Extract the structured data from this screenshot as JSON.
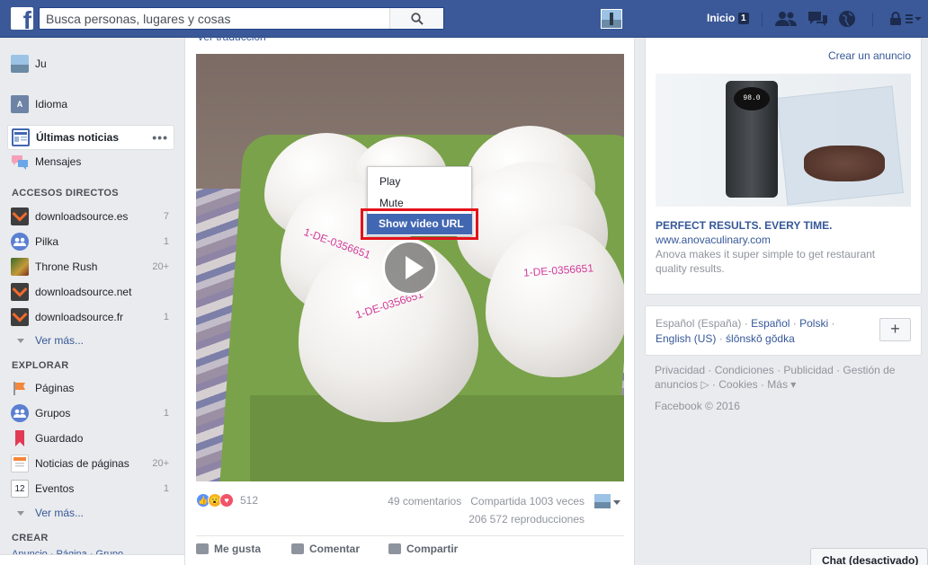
{
  "topbar": {
    "search_placeholder": "Busca personas, lugares y cosas",
    "home_label": "Inicio",
    "home_badge": "1"
  },
  "sidebar": {
    "profile_name": "Ju",
    "language": "Idioma",
    "news_feed": "Últimas noticias",
    "messages": "Mensajes",
    "shortcuts_heading": "ACCESOS DIRECTOS",
    "shortcuts": [
      {
        "label": "downloadsource.es",
        "count": "7"
      },
      {
        "label": "Pilka",
        "count": "1"
      },
      {
        "label": "Throne Rush",
        "count": "20+"
      },
      {
        "label": "downloadsource.net",
        "count": ""
      },
      {
        "label": "downloadsource.fr",
        "count": "1"
      }
    ],
    "see_more_1": "Ver más...",
    "explore_heading": "EXPLORAR",
    "explore": [
      {
        "label": "Páginas",
        "count": ""
      },
      {
        "label": "Grupos",
        "count": "1"
      },
      {
        "label": "Guardado",
        "count": ""
      },
      {
        "label": "Noticias de páginas",
        "count": "20+"
      },
      {
        "label": "Eventos",
        "count": "1"
      }
    ],
    "see_more_2": "Ver más...",
    "create_heading": "CREAR",
    "create_links": "Anuncio · Página · Grupo"
  },
  "post": {
    "translate": "Ver traducción",
    "stamp_text": "1-DE-0356651",
    "context_menu": [
      "Play",
      "Mute",
      "Show video URL"
    ],
    "reactions_count": "512",
    "comments": "49 comentarios",
    "shares": "Compartida 1003 veces",
    "views": "206 572 reproducciones",
    "actions": [
      "Me gusta",
      "Comentar",
      "Compartir"
    ]
  },
  "ad": {
    "create": "Crear un anuncio",
    "screen_text": "98.0",
    "title": "PERFECT RESULTS. EVERY TIME.",
    "url": "www.anovaculinary.com",
    "description": "Anova makes it super simple to get restaurant quality results."
  },
  "languages": {
    "current": "Español (España)",
    "links": [
      "Español",
      "Polski",
      "English (US)",
      "ślōnskŏ gŏdka"
    ],
    "add": "+"
  },
  "footer": {
    "links": "Privacidad · Condiciones · Publicidad · Gestión de anuncios ▷ · Cookies · Más ▾",
    "copyright": "Facebook © 2016"
  },
  "chat": {
    "label": "Chat (desactivado)"
  }
}
